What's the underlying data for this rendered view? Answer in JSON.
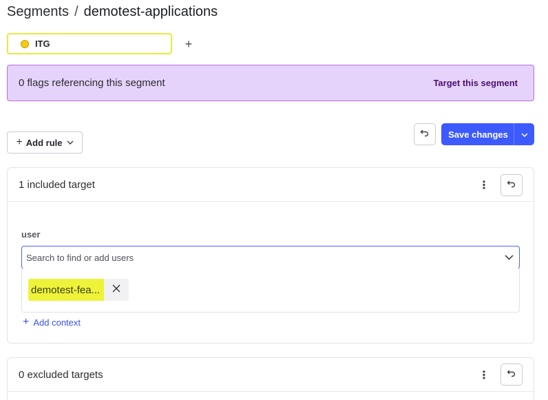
{
  "breadcrumb": {
    "root": "Segments",
    "separator": "/",
    "current": "demotest-applications"
  },
  "environment": {
    "name": "ITG",
    "dot_color": "#f5cc14",
    "border_color": "#e6ec3c",
    "add_icon": "plus-icon"
  },
  "banner": {
    "text": "0 flags referencing this segment",
    "link": "Target this segment",
    "background": "#e6d3fb"
  },
  "toolbar": {
    "add_rule_label": "Add rule",
    "save_label": "Save changes",
    "accent": "#3d5afe",
    "undo_icon": "undo-icon"
  },
  "included": {
    "title": "1 included target",
    "context_label": "user",
    "search_placeholder": "Search to find or add users",
    "targets": [
      "demotest-fea..."
    ],
    "chip_color": "#eef33a",
    "add_context_label": "Add context"
  },
  "excluded": {
    "title": "0 excluded targets"
  }
}
